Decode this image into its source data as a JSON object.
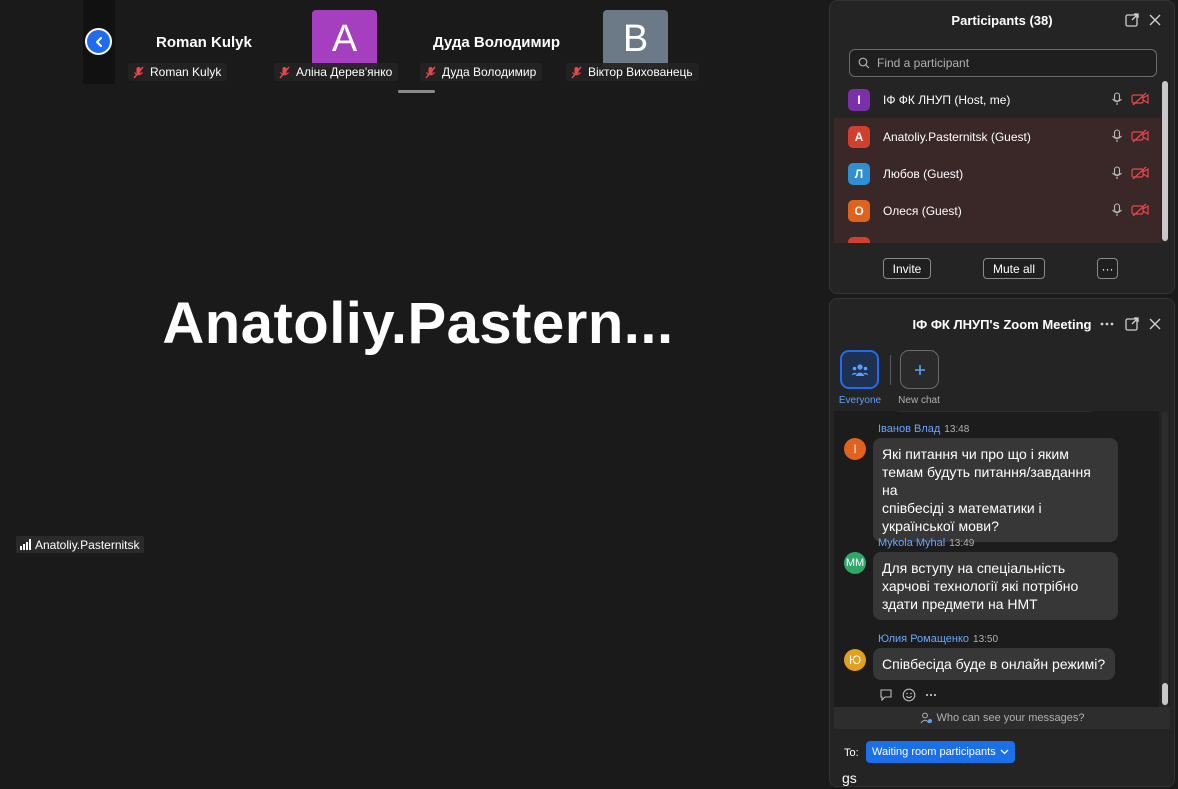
{
  "colors": {
    "background": "#1a1a1a",
    "panel": "#242424",
    "accent": "#1f6cf0",
    "guest_row": "#3a2727",
    "mute_red": "#e5484d",
    "link_blue": "#6aa6ff"
  },
  "video_strip": {
    "tiles": [
      {
        "name": "Roman Kulyk",
        "label": "Roman Kulyk"
      },
      {
        "avatar_letter": "A",
        "avatar_color": "#a63fbf",
        "label": "Аліна Дерев'янко"
      },
      {
        "name": "Дуда Володимир",
        "label": "Дуда Володимир"
      },
      {
        "avatar_letter": "B",
        "avatar_color": "#6b7a86",
        "label": "Віктор Вихованець"
      }
    ]
  },
  "main_view": {
    "speaker_name": "Anatoliy.Pastern...",
    "active_label": "Anatoliy.Pasternitsk"
  },
  "participants": {
    "title": "Participants (38)",
    "search_placeholder": "Find a participant",
    "list": [
      {
        "initial": "І",
        "name": "ІФ ФК ЛНУП (Host, me)",
        "color": "#7b2fa8"
      },
      {
        "initial": "A",
        "name": "Anatoliy.Pasternitsk (Guest)",
        "color": "#d1402f"
      },
      {
        "initial": "Л",
        "name": "Любов (Guest)",
        "color": "#2f8fd1"
      },
      {
        "initial": "О",
        "name": "Олеся (Guest)",
        "color": "#e0621f"
      },
      {
        "initial": "",
        "name": "",
        "color": "#d1402f"
      }
    ],
    "invite_label": "Invite",
    "mute_all_label": "Mute all",
    "more_label": "···"
  },
  "chat": {
    "title": "ІФ ФК ЛНУП's Zoom Meeting",
    "tabs": [
      {
        "label": "Everyone"
      },
      {
        "label": "New chat"
      }
    ],
    "messages": [
      {
        "sender": "Іванов Влад",
        "time": "13:48",
        "initials": "І",
        "avatar_color": "#e0621f",
        "lines": [
          "Які питання чи про що і яким",
          "темам будуть питання/завдання на",
          "співбесіді з математики і",
          "української мови?"
        ]
      },
      {
        "sender": "Mykola Myhal",
        "time": "13:49",
        "initials": "MM",
        "avatar_color": "#2ea86a",
        "lines": [
          "Для вступу на спеціальність",
          "харчові технології які потрібно",
          "здати предмети на НМТ"
        ]
      },
      {
        "sender": "Юлия Ромащенко",
        "time": "13:50",
        "initials": "Ю",
        "avatar_color": "#e0a020",
        "lines": [
          "Співбесіда буде в онлайн режимі?"
        ]
      }
    ],
    "who_can_see": "Who can see your messages?",
    "to_label": "To:",
    "recipient": "Waiting room participants",
    "compose_value": "gs"
  }
}
